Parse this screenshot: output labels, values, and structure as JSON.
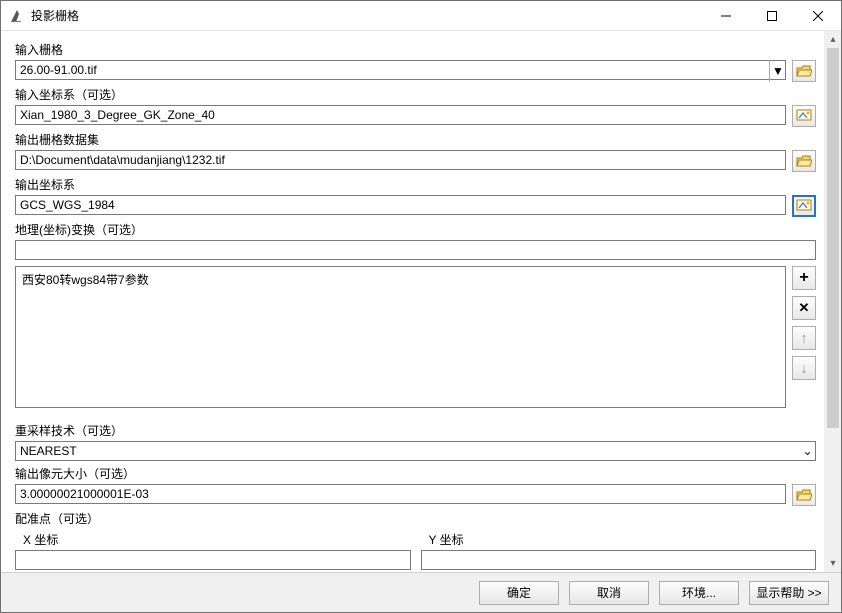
{
  "window": {
    "title": "投影栅格"
  },
  "fields": {
    "input_raster": {
      "label": "输入栅格",
      "value": "26.00-91.00.tif"
    },
    "input_cs": {
      "label": "输入坐标系（可选）",
      "value": "Xian_1980_3_Degree_GK_Zone_40"
    },
    "output_ds": {
      "label": "输出栅格数据集",
      "value": "D:\\Document\\data\\mudanjiang\\1232.tif"
    },
    "output_cs": {
      "label": "输出坐标系",
      "value": "GCS_WGS_1984"
    },
    "geo_trans": {
      "label": "地理(坐标)变换（可选）",
      "value": ""
    },
    "geo_trans_list": {
      "items": [
        "西安80转wgs84带7参数"
      ]
    },
    "resample": {
      "label": "重采样技术（可选）",
      "value": "NEAREST"
    },
    "cellsize": {
      "label": "输出像元大小（可选）",
      "value": "3.00000021000001E-03"
    },
    "regpoint": {
      "label": "配准点（可选）",
      "xlabel": "X 坐标",
      "ylabel": "Y 坐标",
      "x": "",
      "y": ""
    }
  },
  "buttons": {
    "ok": "确定",
    "cancel": "取消",
    "env": "环境...",
    "help": "显示帮助 >>"
  },
  "icons": {
    "folder": "folder-open",
    "cs": "coordinate-system",
    "add": "+",
    "remove": "✕",
    "up": "↑",
    "down": "↓"
  }
}
